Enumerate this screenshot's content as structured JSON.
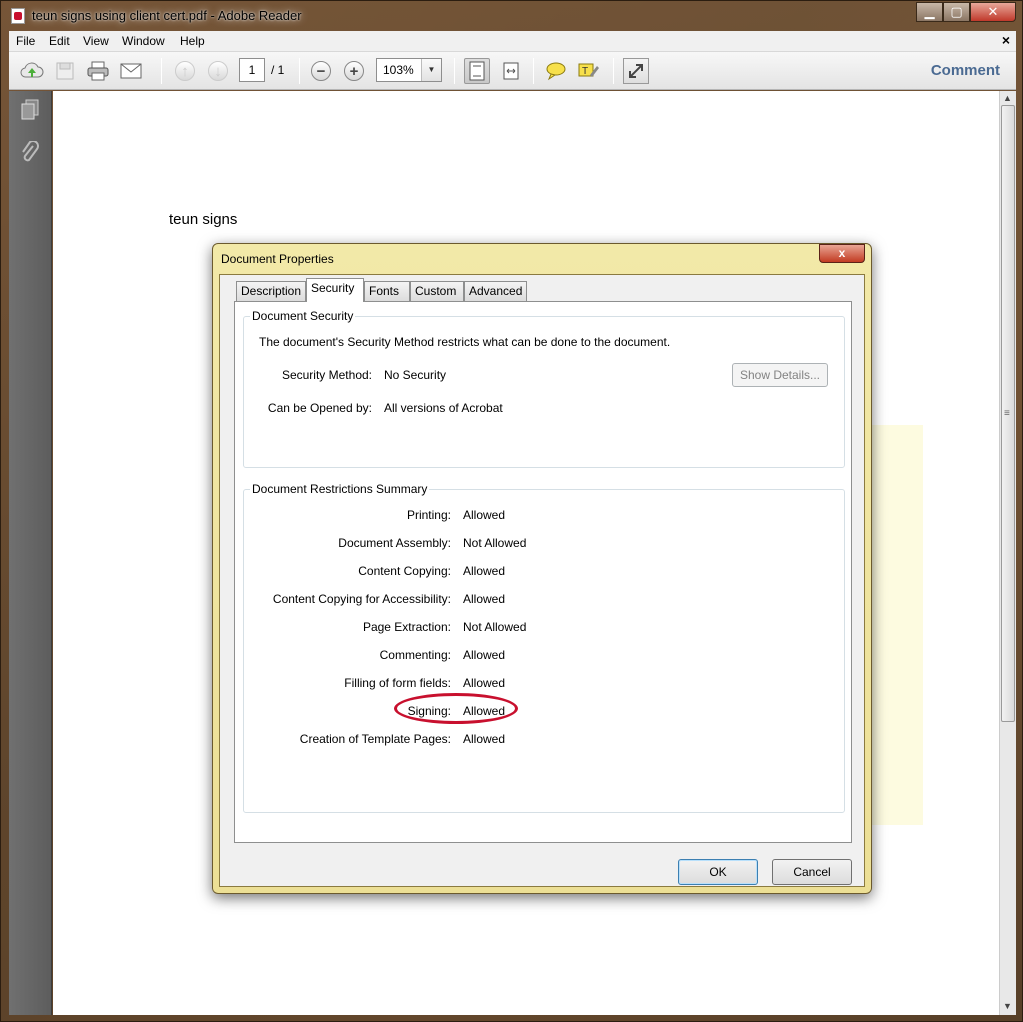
{
  "window": {
    "title": "teun signs using client cert.pdf - Adobe Reader"
  },
  "menubar": {
    "items": [
      "File",
      "Edit",
      "View",
      "Window",
      "Help"
    ],
    "close_glyph": "×"
  },
  "toolbar": {
    "page_current": "1",
    "page_total": "/ 1",
    "zoom": "103%",
    "comment_label": "Comment"
  },
  "document": {
    "text": "teun signs"
  },
  "dialog": {
    "title": "Document Properties",
    "close_glyph": "x",
    "tabs": [
      "Description",
      "Security",
      "Fonts",
      "Custom",
      "Advanced"
    ],
    "active_tab": "Security",
    "security_group": {
      "legend": "Document Security",
      "intro": "The document's Security Method restricts what can be done to the document.",
      "method_label": "Security Method:",
      "method_value": "No Security",
      "opened_label": "Can be Opened by:",
      "opened_value": "All versions of Acrobat",
      "show_details_label": "Show Details..."
    },
    "restrictions_group": {
      "legend": "Document Restrictions Summary",
      "rows": [
        {
          "label": "Printing:",
          "value": "Allowed"
        },
        {
          "label": "Document Assembly:",
          "value": "Not Allowed"
        },
        {
          "label": "Content Copying:",
          "value": "Allowed"
        },
        {
          "label": "Content Copying for Accessibility:",
          "value": "Allowed"
        },
        {
          "label": "Page Extraction:",
          "value": "Not Allowed"
        },
        {
          "label": "Commenting:",
          "value": "Allowed"
        },
        {
          "label": "Filling of form fields:",
          "value": "Allowed"
        },
        {
          "label": "Signing:",
          "value": "Allowed"
        },
        {
          "label": "Creation of Template Pages:",
          "value": "Allowed"
        }
      ]
    },
    "ok_label": "OK",
    "cancel_label": "Cancel"
  },
  "colors": {
    "highlight": "#c8102e",
    "comment_link": "#4a6a92",
    "dialog_frame": "#ecdf95"
  }
}
